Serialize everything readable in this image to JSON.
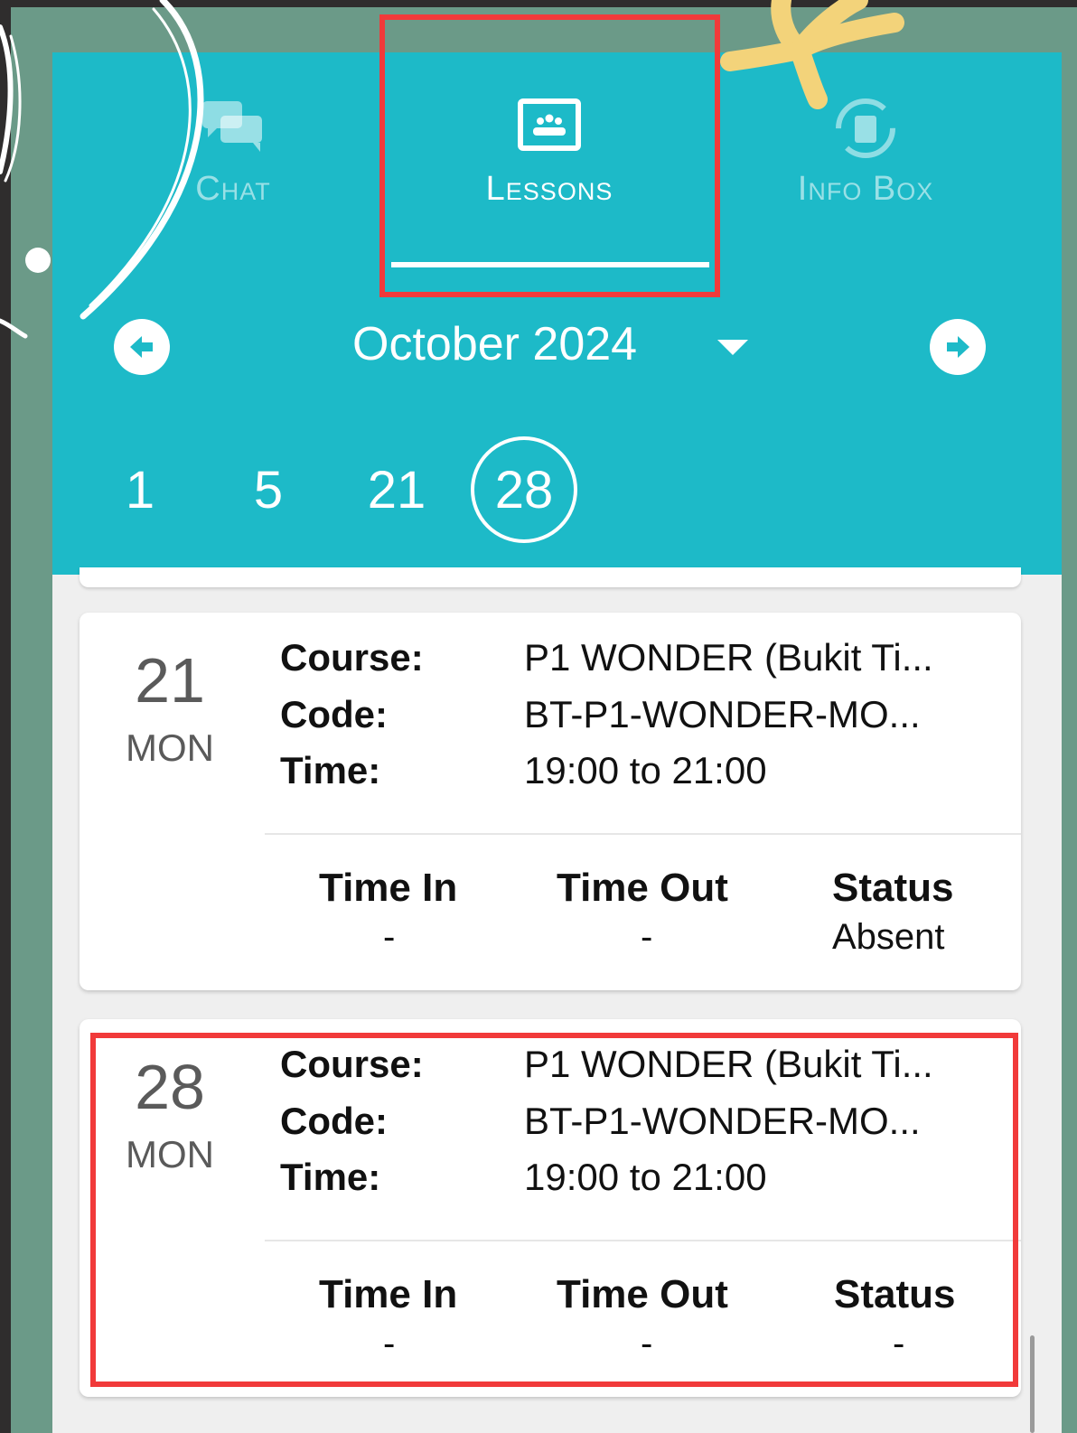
{
  "tabs": [
    {
      "label": "Chat",
      "icon": "chat-bubbles-icon",
      "active": false
    },
    {
      "label": "Lessons",
      "icon": "classroom-board-icon",
      "active": true
    },
    {
      "label": "Info Box",
      "icon": "info-box-sync-icon",
      "active": false
    }
  ],
  "calendar": {
    "month": "October 2024",
    "dates": [
      "1",
      "5",
      "21",
      "28"
    ],
    "selected_date": "28"
  },
  "lessons": [
    {
      "day": "21",
      "weekday": "MON",
      "course_label": "Course:",
      "course": "P1 WONDER (Bukit Ti...",
      "code_label": "Code:",
      "code": "BT-P1-WONDER-MO...",
      "time_label": "Time:",
      "time": "19:00 to 21:00",
      "time_in_label": "Time In",
      "time_in": "-",
      "time_out_label": "Time Out",
      "time_out": "-",
      "status_label": "Status",
      "status": "Absent"
    },
    {
      "day": "28",
      "weekday": "MON",
      "course_label": "Course:",
      "course": "P1 WONDER (Bukit Ti...",
      "code_label": "Code:",
      "code": "BT-P1-WONDER-MO...",
      "time_label": "Time:",
      "time": "19:00 to 21:00",
      "time_in_label": "Time In",
      "time_in": "-",
      "time_out_label": "Time Out",
      "time_out": "-",
      "status_label": "Status",
      "status": "-"
    }
  ],
  "colors": {
    "header": "#1dbac8",
    "highlight": "#f13a3a",
    "background": "#6b9a88",
    "scribble": "#f3d37a"
  }
}
